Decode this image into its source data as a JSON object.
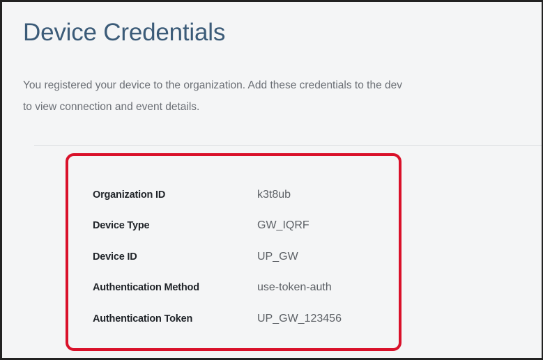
{
  "page": {
    "title": "Device Credentials",
    "description_lines": [
      "You registered your device to the organization. Add these credentials to the dev",
      "to view connection and event details."
    ]
  },
  "credentials": [
    {
      "label": "Organization ID",
      "value": "k3t8ub"
    },
    {
      "label": "Device Type",
      "value": "GW_IQRF"
    },
    {
      "label": "Device ID",
      "value": "UP_GW"
    },
    {
      "label": "Authentication Method",
      "value": "use-token-auth"
    },
    {
      "label": "Authentication Token",
      "value": "UP_GW_123456"
    }
  ],
  "colors": {
    "title": "#3b5b78",
    "highlight_border": "#d9112a",
    "background": "#f4f5f6"
  }
}
